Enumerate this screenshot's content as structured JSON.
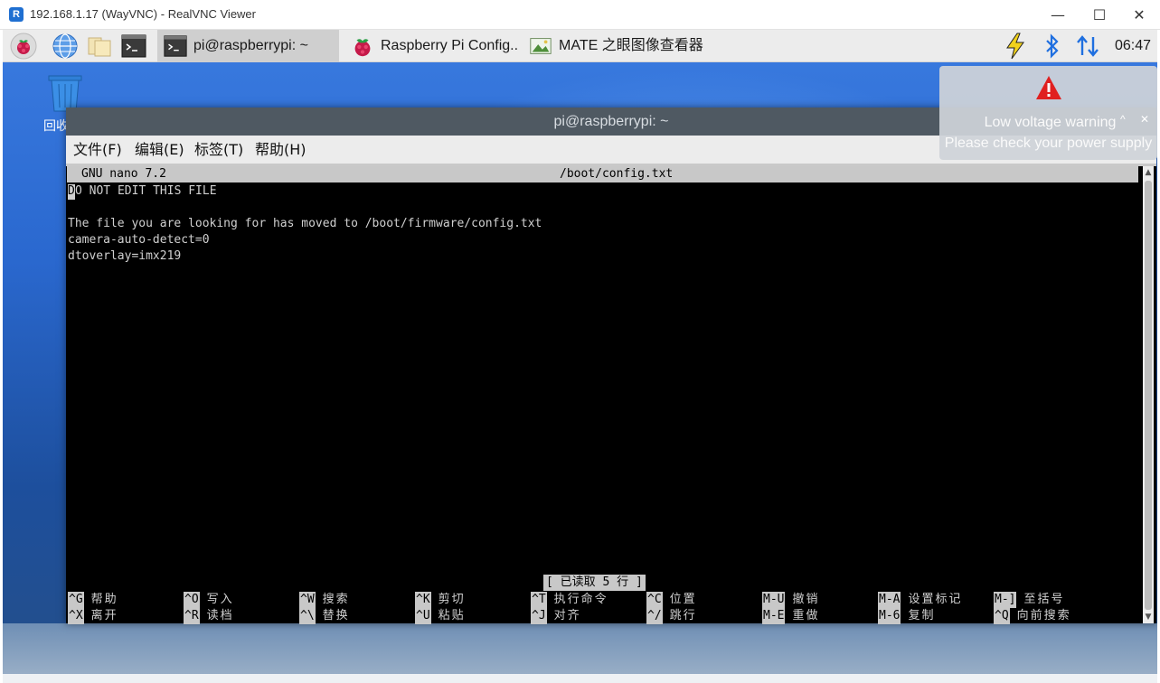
{
  "viewer": {
    "title": "192.168.1.17 (WayVNC) - RealVNC Viewer",
    "app_icon_letter": "R",
    "minimize_glyph": "—",
    "maximize_glyph": "☐",
    "close_glyph": "✕"
  },
  "panel": {
    "launchers": [
      "raspberry-pi-menu-icon",
      "web-browser-icon",
      "file-manager-icon",
      "terminal-icon"
    ],
    "tasks": [
      {
        "label": "pi@raspberrypi: ~",
        "icon": "terminal-icon",
        "active": true
      },
      {
        "label": "Raspberry Pi Config..",
        "icon": "raspberry-icon",
        "active": false
      },
      {
        "label": "MATE 之眼图像查看器",
        "icon": "image-viewer-icon",
        "active": false
      }
    ],
    "tray": {
      "icons": [
        "low-voltage-bolt-icon",
        "bluetooth-icon",
        "network-icon"
      ],
      "clock": "06:47"
    }
  },
  "desktop": {
    "trash_label": "回收"
  },
  "terminal": {
    "title": "pi@raspberrypi: ~",
    "menu": [
      "文件(F)",
      "编辑(E)",
      "标签(T)",
      "帮助(H)"
    ]
  },
  "nano": {
    "version": "GNU nano 7.2",
    "filename": "/boot/config.txt",
    "cursor_char": "D",
    "lines": [
      "O NOT EDIT THIS FILE",
      "",
      "The file you are looking for has moved to /boot/firmware/config.txt",
      "camera-auto-detect=0",
      "dtoverlay=imx219"
    ],
    "status": "[ 已读取 5 行 ]",
    "shortcuts_row1": [
      {
        "key": "^G",
        "desc": "帮助"
      },
      {
        "key": "^O",
        "desc": "写入"
      },
      {
        "key": "^W",
        "desc": "搜索"
      },
      {
        "key": "^K",
        "desc": "剪切"
      },
      {
        "key": "^T",
        "desc": "执行命令"
      },
      {
        "key": "^C",
        "desc": "位置"
      },
      {
        "key": "M-U",
        "desc": "撤销"
      },
      {
        "key": "M-A",
        "desc": "设置标记"
      },
      {
        "key": "M-]",
        "desc": "至括号"
      }
    ],
    "shortcuts_row2": [
      {
        "key": "^X",
        "desc": "离开"
      },
      {
        "key": "^R",
        "desc": "读档"
      },
      {
        "key": "^\\",
        "desc": "替换"
      },
      {
        "key": "^U",
        "desc": "粘贴"
      },
      {
        "key": "^J",
        "desc": "对齐"
      },
      {
        "key": "^/",
        "desc": "跳行"
      },
      {
        "key": "M-E",
        "desc": "重做"
      },
      {
        "key": "M-6",
        "desc": "复制"
      },
      {
        "key": "^Q",
        "desc": "向前搜索"
      }
    ]
  },
  "notification": {
    "title": "Low voltage warning",
    "message": "Please check your power supply",
    "close_glyph": "✕",
    "caret_glyph": "^",
    "icon": "warning-triangle-icon",
    "accent": "#e02020"
  }
}
